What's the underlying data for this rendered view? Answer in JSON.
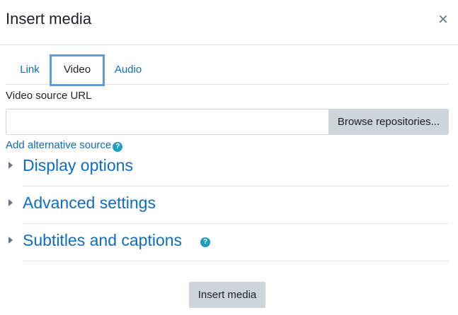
{
  "dialog": {
    "title": "Insert media",
    "close_symbol": "×"
  },
  "tabs": [
    {
      "label": "Link",
      "active": false
    },
    {
      "label": "Video",
      "active": true
    },
    {
      "label": "Audio",
      "active": false
    }
  ],
  "video": {
    "source_label": "Video source URL",
    "source_value": "",
    "browse_label": "Browse repositories...",
    "add_alternative_label": "Add alternative source"
  },
  "sections": [
    {
      "label": "Display options",
      "expanded": false,
      "has_help": false
    },
    {
      "label": "Advanced settings",
      "expanded": false,
      "has_help": false
    },
    {
      "label": "Subtitles and captions",
      "expanded": false,
      "has_help": true
    }
  ],
  "help_symbol": "?",
  "footer": {
    "insert_label": "Insert media"
  },
  "colors": {
    "link": "#0f6cbf",
    "active_tab_border": "#5e9ed6",
    "button_bg": "#ced4da",
    "help_icon": "#1f9fbd"
  },
  "icons": {
    "close": "close-icon",
    "help": "help-icon",
    "section_toggle": "caret-right-icon"
  }
}
